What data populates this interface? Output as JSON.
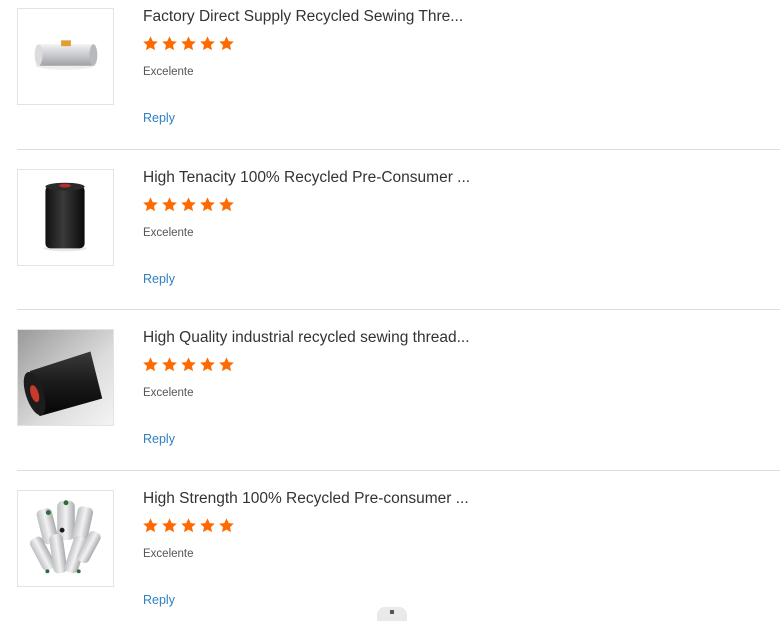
{
  "star_color": "#ff6a00",
  "link_color": "#2f7fc1",
  "reviews": [
    {
      "title": "Factory Direct Supply Recycled Sewing Thre...",
      "rating": 5,
      "max_rating": 5,
      "comment": "Excelente",
      "reply_label": "Reply",
      "image": "white-thread-spool"
    },
    {
      "title": "High Tenacity 100% Recycled Pre-Consumer ...",
      "rating": 5,
      "max_rating": 5,
      "comment": "Excelente",
      "reply_label": "Reply",
      "image": "black-thread-cone"
    },
    {
      "title": "High Quality industrial recycled sewing thread...",
      "rating": 5,
      "max_rating": 5,
      "comment": "Excelente",
      "reply_label": "Reply",
      "image": "black-thread-cone-side"
    },
    {
      "title": "High Strength 100% Recycled Pre-consumer ...",
      "rating": 5,
      "max_rating": 5,
      "comment": "Excelente",
      "reply_label": "Reply",
      "image": "white-thread-cones-group"
    }
  ]
}
